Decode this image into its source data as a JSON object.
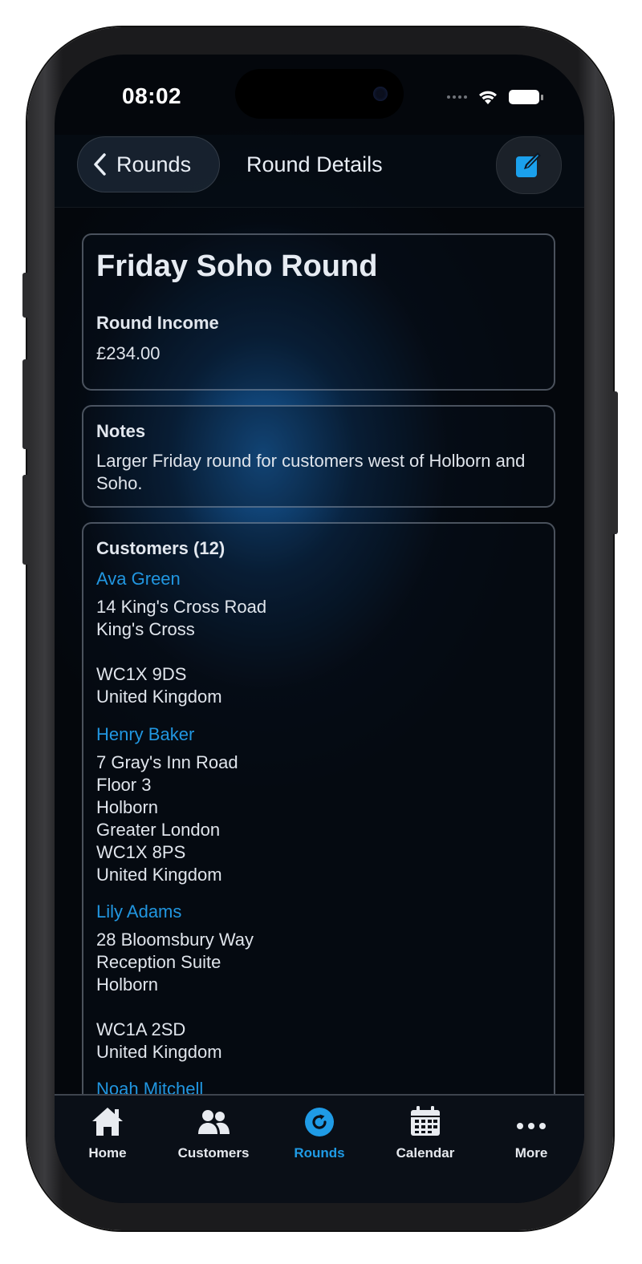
{
  "status_bar": {
    "time": "08:02"
  },
  "nav": {
    "back_label": "Rounds",
    "title": "Round Details"
  },
  "round": {
    "name": "Friday Soho Round",
    "income_label": "Round Income",
    "income_value": "£234.00"
  },
  "notes": {
    "label": "Notes",
    "text": "Larger Friday round for customers west of Holborn and Soho."
  },
  "customers": {
    "heading": "Customers (12)",
    "items": [
      {
        "name": "Ava Green",
        "address": "14 King's Cross Road\nKing's Cross\n\nWC1X 9DS\nUnited Kingdom"
      },
      {
        "name": "Henry Baker",
        "address": "7 Gray's Inn Road\nFloor 3\nHolborn\nGreater London\nWC1X 8PS\nUnited Kingdom"
      },
      {
        "name": "Lily Adams",
        "address": "28 Bloomsbury Way\nReception Suite\nHolborn\n\nWC1A 2SD\nUnited Kingdom"
      },
      {
        "name": "Noah Mitchell",
        "address": ""
      }
    ]
  },
  "tabs": [
    {
      "label": "Home",
      "icon": "home-icon"
    },
    {
      "label": "Customers",
      "icon": "customers-icon"
    },
    {
      "label": "Rounds",
      "icon": "rounds-icon",
      "active": true
    },
    {
      "label": "Calendar",
      "icon": "calendar-icon"
    },
    {
      "label": "More",
      "icon": "more-icon"
    }
  ],
  "colors": {
    "accent": "#1f9be6",
    "link": "#2196e0",
    "background": "#04070c"
  }
}
